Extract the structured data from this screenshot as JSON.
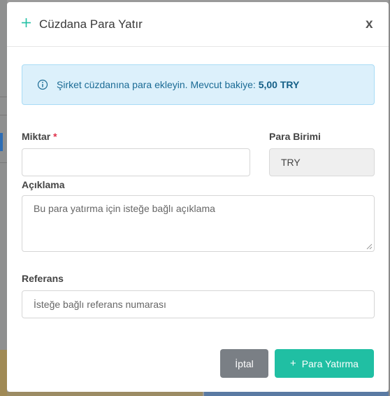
{
  "modal": {
    "title": "Cüzdana Para Yatır",
    "close_label": "x"
  },
  "info": {
    "message": "Şirket cüzdanına para ekleyin. Mevcut bakiye: ",
    "balance": "5,00 TRY"
  },
  "form": {
    "amount_label": "Miktar",
    "amount_required_mark": "*",
    "amount_value": "",
    "currency_label": "Para Birimi",
    "currency_value": "TRY",
    "description_label": "Açıklama",
    "description_placeholder": "Bu para yatırma için isteğe bağlı açıklama",
    "reference_label": "Referans",
    "reference_placeholder": "İsteğe bağlı referans numarası"
  },
  "buttons": {
    "cancel_label": "İptal",
    "deposit_label": "Para Yatırma"
  },
  "colors": {
    "accent": "#20bfa3",
    "info_bg": "#dcf0fb",
    "info_text": "#1b6b95",
    "required": "#e0304a",
    "cancel_bg": "#7a7f85"
  },
  "icons": {
    "title_icon": "plus-icon",
    "info_icon": "info-circle-icon",
    "deposit_icon": "plus-icon"
  }
}
